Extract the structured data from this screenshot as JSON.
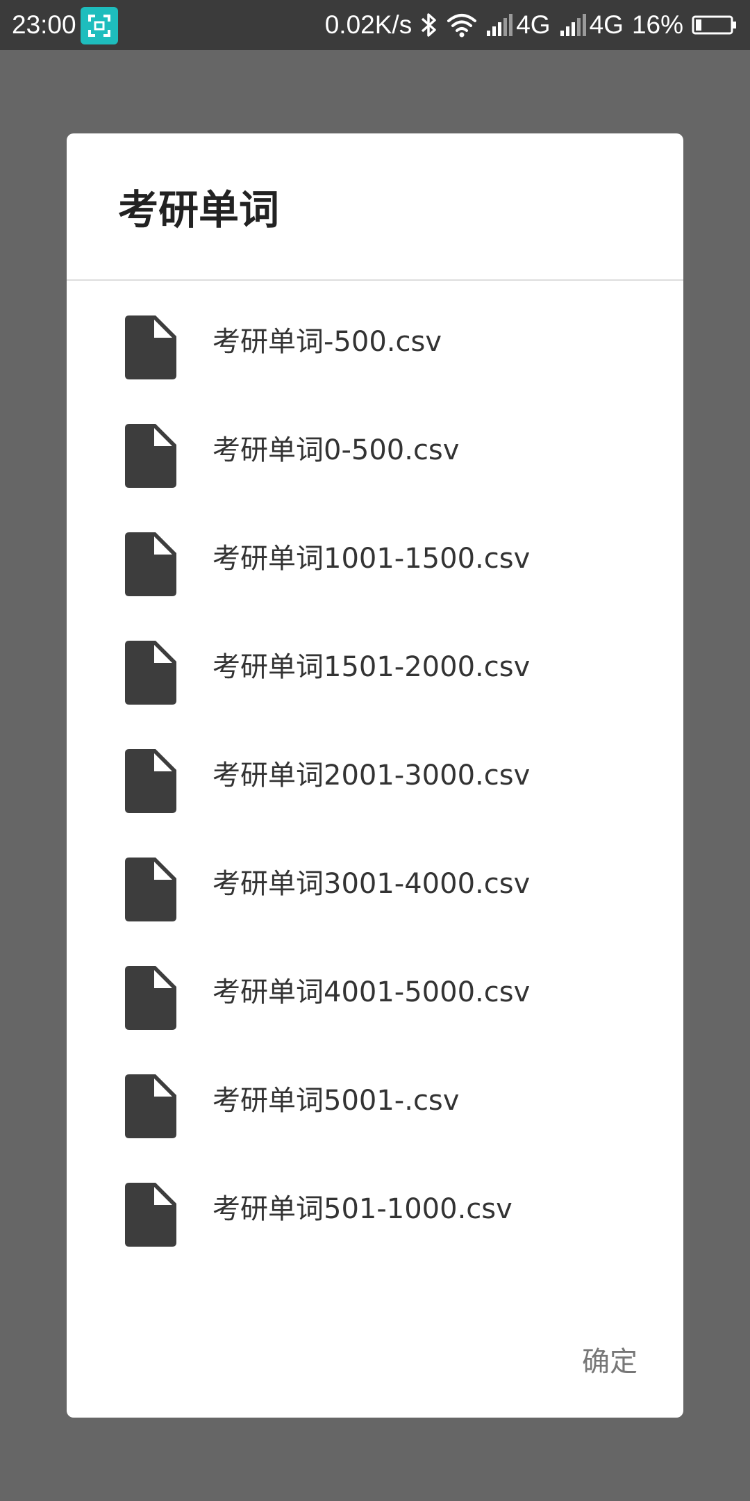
{
  "status_bar": {
    "time": "23:00",
    "net_speed": "0.02K/s",
    "network_1": "4G",
    "network_2": "4G",
    "battery": "16%",
    "icons": [
      "screenshot-icon",
      "bluetooth-icon",
      "wifi-icon",
      "signal-icon",
      "signal-icon",
      "battery-icon"
    ]
  },
  "dialog": {
    "title": "考研单词",
    "files": [
      {
        "name": "考研单词-500.csv",
        "icon": "file-icon"
      },
      {
        "name": "考研单词0-500.csv",
        "icon": "file-icon"
      },
      {
        "name": "考研单词1001-1500.csv",
        "icon": "file-icon"
      },
      {
        "name": "考研单词1501-2000.csv",
        "icon": "file-icon"
      },
      {
        "name": "考研单词2001-3000.csv",
        "icon": "file-icon"
      },
      {
        "name": "考研单词3001-4000.csv",
        "icon": "file-icon"
      },
      {
        "name": "考研单词4001-5000.csv",
        "icon": "file-icon"
      },
      {
        "name": "考研单词5001-.csv",
        "icon": "file-icon"
      },
      {
        "name": "考研单词501-1000.csv",
        "icon": "file-icon"
      }
    ],
    "confirm_label": "确定"
  },
  "colors": {
    "scrim": "#666666",
    "status_bar": "#3b3b3b",
    "dialog_bg": "#ffffff",
    "file_icon": "#3d3d3d",
    "accent_badge": "#1ebdbd",
    "confirm_text": "#777777"
  }
}
